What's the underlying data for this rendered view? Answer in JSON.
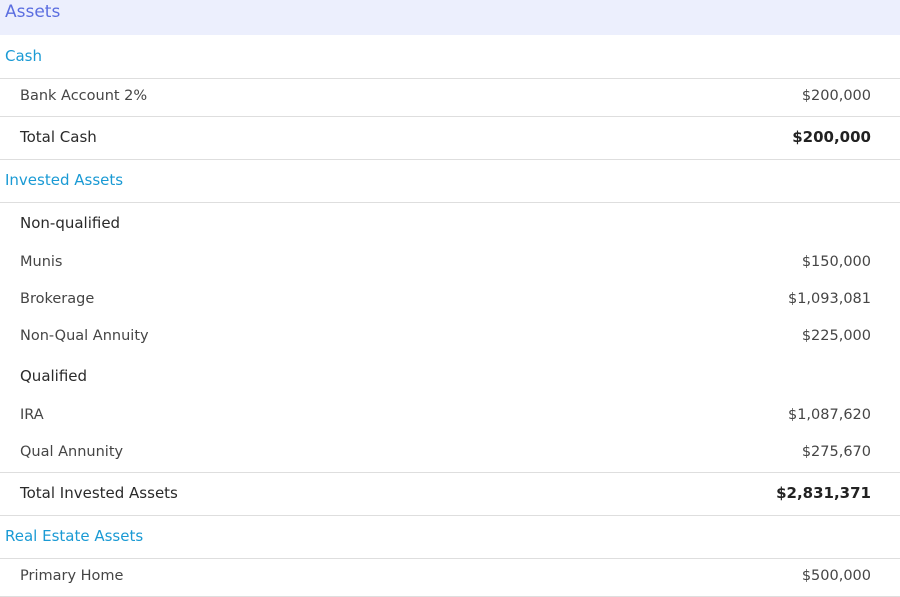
{
  "header": {
    "title": "Assets"
  },
  "sections": {
    "cash": {
      "label": "Cash",
      "items": [
        {
          "label": "Bank Account 2%",
          "value": "$200,000"
        }
      ],
      "total": {
        "label": "Total Cash",
        "value": "$200,000"
      }
    },
    "invested": {
      "label": "Invested Assets",
      "groups": [
        {
          "label": "Non-qualified",
          "items": [
            {
              "label": "Munis",
              "value": "$150,000"
            },
            {
              "label": "Brokerage",
              "value": "$1,093,081"
            },
            {
              "label": "Non-Qual Annuity",
              "value": "$225,000"
            }
          ]
        },
        {
          "label": "Qualified",
          "items": [
            {
              "label": "IRA",
              "value": "$1,087,620"
            },
            {
              "label": "Qual Annunity",
              "value": "$275,670"
            }
          ]
        }
      ],
      "total": {
        "label": "Total Invested Assets",
        "value": "$2,831,371"
      }
    },
    "real_estate": {
      "label": "Real Estate Assets",
      "items": [
        {
          "label": "Primary Home",
          "value": "$500,000"
        }
      ]
    }
  }
}
